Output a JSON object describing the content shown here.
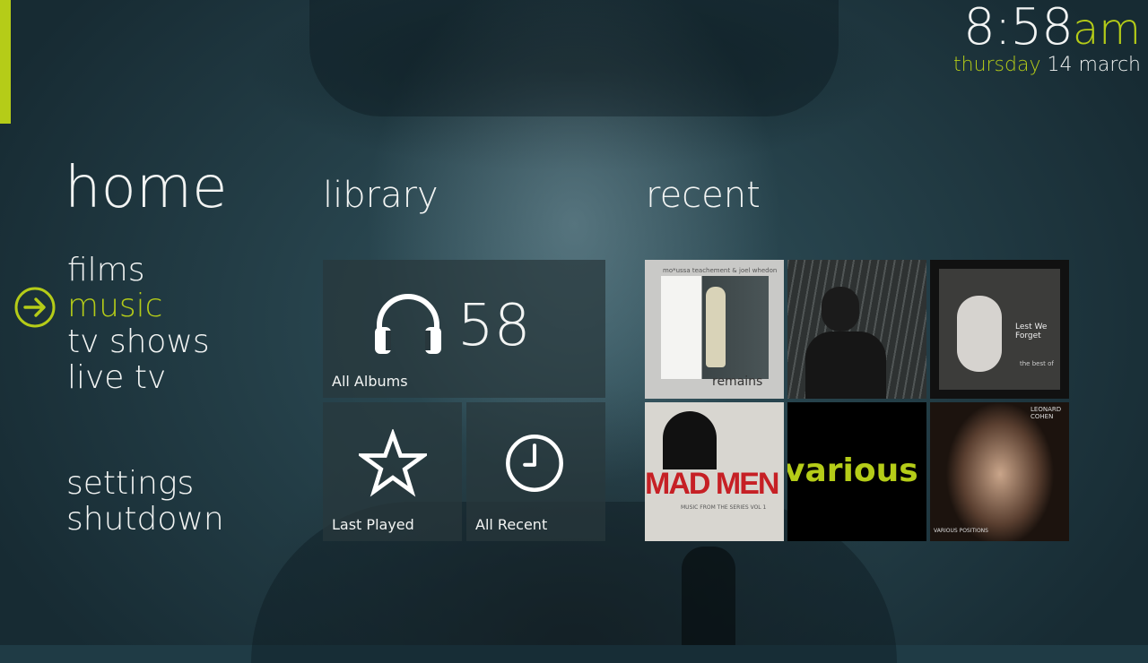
{
  "clock": {
    "time": "8:58",
    "ampm": "am",
    "weekday": "thursday",
    "date": "14 march"
  },
  "colors": {
    "accent": "#b5cc18",
    "text": "#f2f4f3",
    "tile": "#28373c"
  },
  "home": {
    "title": "home"
  },
  "nav": {
    "items": [
      {
        "label": "films",
        "selected": false
      },
      {
        "label": "music",
        "selected": true
      },
      {
        "label": "tv shows",
        "selected": false
      },
      {
        "label": "live tv",
        "selected": false
      }
    ],
    "bottom": [
      {
        "label": "settings"
      },
      {
        "label": "shutdown"
      }
    ],
    "selected_icon": "arrow-right-circle-icon"
  },
  "library": {
    "title": "library",
    "all_albums": {
      "label": "All Albums",
      "count": "58",
      "icon": "headphones-icon"
    },
    "last_played": {
      "label": "Last Played",
      "icon": "star-icon"
    },
    "all_recent": {
      "label": "All Recent",
      "icon": "clock-icon"
    }
  },
  "recent": {
    "title": "recent",
    "covers": [
      {
        "text": "remains",
        "subtext": "mo*ussa teachement & joel whedon"
      },
      {
        "text": ""
      },
      {
        "text": "Lest We Forget",
        "subtext": "the best of"
      },
      {
        "text": "MAD MEN",
        "subtext": "MUSIC FROM THE SERIES VOL 1"
      },
      {
        "text": "various a"
      },
      {
        "text": "LEONARD COHEN",
        "subtext": "VARIOUS POSITIONS"
      }
    ]
  }
}
